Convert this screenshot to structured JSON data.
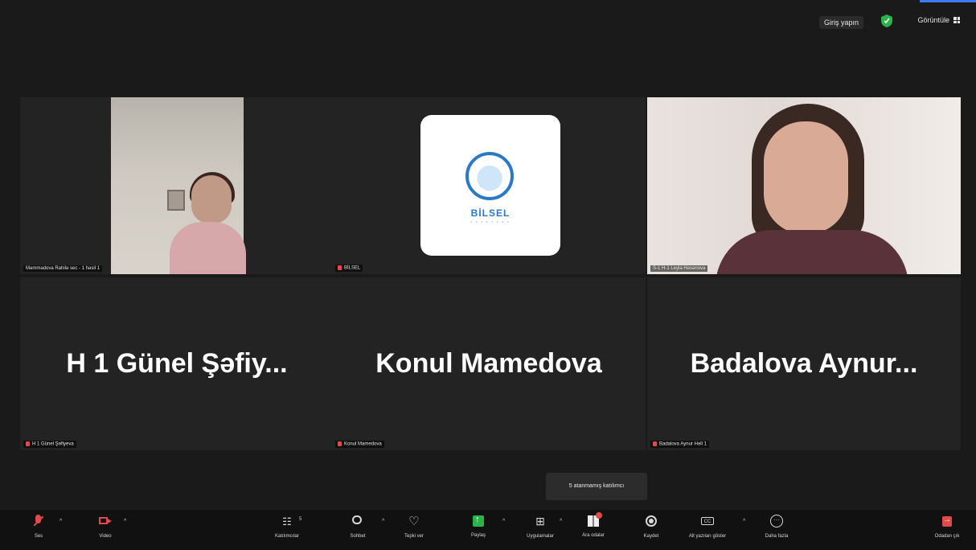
{
  "topbar": {
    "signin_label": "Giriş yapın",
    "view_label": "Görüntüle"
  },
  "tiles_top": [
    {
      "name": "Məmmədova Rahilə sec - 1 həsil 1"
    },
    {
      "name": "BİLSEL"
    },
    {
      "name": "S-1 H-1 Leyla Həsənova"
    }
  ],
  "logo": {
    "text": "BİLSEL",
    "subtext": "• • • • • • • •"
  },
  "tiles_bottom": [
    {
      "display": "H 1 Günel Şəfiy...",
      "name": "H 1 Günel Şəfiyeva"
    },
    {
      "display": "Konul Mamedova",
      "name": "Konul Mamedova"
    },
    {
      "display": "Badalova  Aynur...",
      "name": "Badalova Aynur Həll 1"
    }
  ],
  "tooltip": {
    "text": "5 atanmamış katılımcı"
  },
  "toolbar": {
    "audio": "Ses",
    "video": "Video",
    "participants": "Katılımcılar",
    "participants_count": "5",
    "chat": "Sohbet",
    "reactions": "Tepki ver",
    "share": "Paylaş",
    "apps": "Uygulamalar",
    "breakout": "Ara odalar",
    "record": "Kaydet",
    "captions": "Alt yazıları göster",
    "more": "Daha fazla",
    "leave": "Odadan çık"
  },
  "colors": {
    "accent_green": "#3ad07a",
    "muted_red": "#e04a4a",
    "share_green": "#2bb34a",
    "logo_blue": "#2a79c8"
  }
}
